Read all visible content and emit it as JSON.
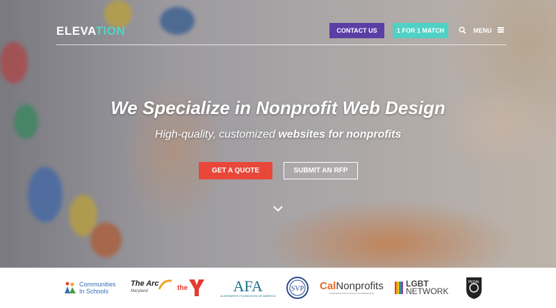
{
  "header": {
    "logo_main": "ELEVA",
    "logo_accent": "TION",
    "contact_label": "CONTACT US",
    "match_label": "1 FOR 1 MATCH",
    "menu_label": "MENU",
    "icons": [
      "search-icon",
      "hamburger-icon"
    ]
  },
  "hero": {
    "headline": "We Specialize in Nonprofit Web Design",
    "subhead_prefix": "High-quality, customized ",
    "subhead_bold": "websites for nonprofits",
    "quote_label": "GET A QUOTE",
    "rfp_label": "SUBMIT AN RFP",
    "scroll_icon": "chevron-down-icon"
  },
  "partners": {
    "cis_line1": "Communities",
    "cis_line2": "In Schools",
    "arc_name": "The Arc",
    "arc_sub": "Maryland",
    "ymca": "the",
    "afa_name": "AFA",
    "afa_sub": "ALZHEIMER'S FOUNDATION OF AMERICA",
    "cal_prefix": "Cal",
    "cal_name": "Nonprofits",
    "cal_sub": "CALIFORNIA ASSOCIATION OF NONPROFITS",
    "lgbt_line1": "LGBT",
    "lgbt_line2": "NETWORK",
    "pedal": "PEDAL REVOLUTION"
  },
  "colors": {
    "accent_teal": "#4fd6c4",
    "contact_purple": "#5b3ea5",
    "quote_red": "#e8473a"
  }
}
